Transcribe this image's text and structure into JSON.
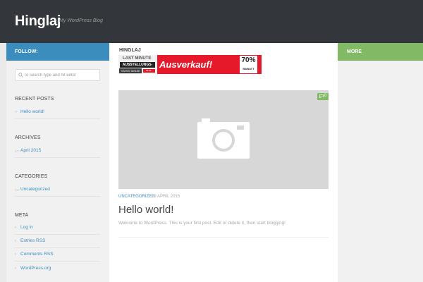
{
  "site": {
    "title": "Hinglaj",
    "description": "My WordPress Blog"
  },
  "sidebar_left": {
    "follow_label": "FOLLOW:",
    "search": {
      "placeholder": "To search type and hit enter",
      "value": ""
    },
    "recent_posts": {
      "title": "RECENT POSTS",
      "items": [
        "Hello world!"
      ]
    },
    "archives": {
      "title": "ARCHIVES",
      "items": [
        "April 2015"
      ]
    },
    "categories": {
      "title": "CATEGORIES",
      "items": [
        "Uncategorized"
      ]
    },
    "meta": {
      "title": "META",
      "items": [
        "Log in",
        "Entries RSS",
        "Comments RSS",
        "WordPress.org"
      ]
    }
  },
  "sidebar_right": {
    "more_label": "MORE"
  },
  "main": {
    "section_label": "HINGLAJ",
    "ad": {
      "last_minute": "LAST MINUTE",
      "ausstellungs": "AUSSTELLUNGS-",
      "brand": "SWISS SENSE",
      "date": "##.##.-##.##.",
      "headline": "Ausverkauf!",
      "percent": "70%",
      "rabatt": "RABATT"
    },
    "post": {
      "comment_count": "0",
      "category": "UNCATEGORIZED",
      "date": "29 APRIL 2015",
      "title": "Hello world!",
      "excerpt": "Welcome to WordPress. This is your first post. Edit or delete it, then start blogging!"
    }
  },
  "colors": {
    "header_bg": "#33363b",
    "follow_bar": "#3b8dbd",
    "more_bar": "#82b965",
    "link": "#3b8dbd",
    "sidebar_bg": "#f1f1f1",
    "page_bg": "#eaeaea"
  }
}
